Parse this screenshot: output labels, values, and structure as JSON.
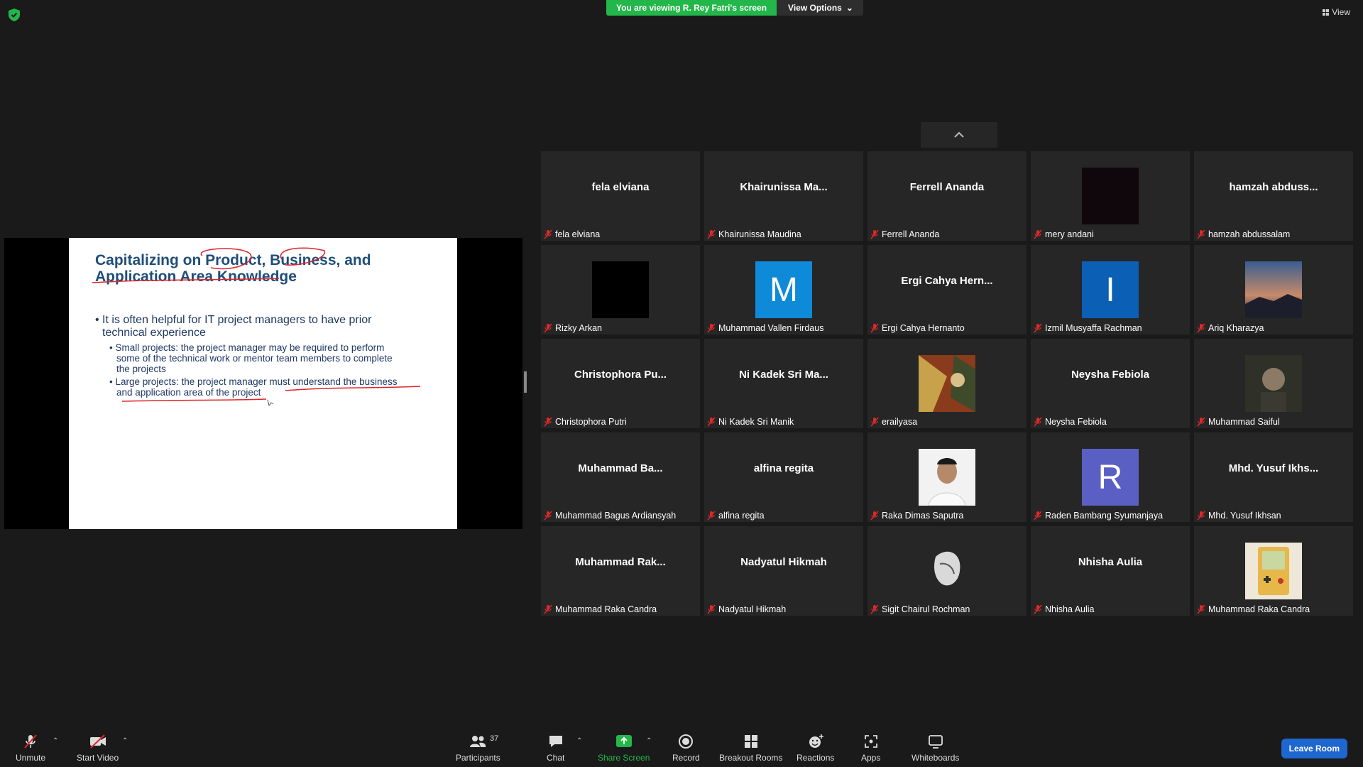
{
  "banner": {
    "viewing_text": "You are viewing R. Rey Fatri's screen",
    "view_options": "View Options"
  },
  "view_label": "View",
  "slide": {
    "title_line1": "Capitalizing on Product, Business, and",
    "title_line2": "Application Area Knowledge",
    "bullet1_line1": "• It is often helpful for IT project managers to have prior",
    "bullet1_line2": "technical experience",
    "sub1_line1": "• Small projects: the project manager may be required to perform",
    "sub1_line2": "some of the technical work or mentor team members to complete",
    "sub1_line3": "the projects",
    "sub2_line1": "• Large projects: the project manager must understand the business",
    "sub2_line2": "and application area of the project"
  },
  "colors": {
    "accent_green": "#23b64a",
    "leave_blue": "#1e66d0",
    "mute_red": "#e02828",
    "tile_bg": "#262626"
  },
  "participants": [
    {
      "display": "fela elviana",
      "name": "fela elviana",
      "avatar": "none"
    },
    {
      "display": "Khairunissa  Ma...",
      "name": "Khairunissa Maudina",
      "avatar": "none"
    },
    {
      "display": "Ferrell Ananda",
      "name": "Ferrell Ananda",
      "avatar": "none"
    },
    {
      "display": "",
      "name": "mery andani",
      "avatar": "dark-photo"
    },
    {
      "display": "hamzah  abduss...",
      "name": "hamzah abdussalam",
      "avatar": "none"
    },
    {
      "display": "",
      "name": "Rizky Arkan",
      "avatar": "black-photo"
    },
    {
      "display": "M",
      "name": "Muhammad Vallen Firdaus",
      "avatar": "letter",
      "color": "#0e8ad9"
    },
    {
      "display": "Ergi  Cahya  Hern...",
      "name": "Ergi Cahya Hernanto",
      "avatar": "none"
    },
    {
      "display": "I",
      "name": "Izmil Musyaffa Rachman",
      "avatar": "letter",
      "color": "#0b5fb5"
    },
    {
      "display": "",
      "name": "Ariq Kharazya",
      "avatar": "sunset-photo"
    },
    {
      "display": "Christophora  Pu...",
      "name": "Christophora Putri",
      "avatar": "none"
    },
    {
      "display": "Ni Kadek Sri Ma...",
      "name": "Ni Kadek Sri Manik",
      "avatar": "none"
    },
    {
      "display": "",
      "name": "erailyasa",
      "avatar": "painting-photo"
    },
    {
      "display": "Neysha Febiola",
      "name": "Neysha Febiola",
      "avatar": "none"
    },
    {
      "display": "",
      "name": "Muhammad Saiful",
      "avatar": "portrait-photo"
    },
    {
      "display": "Muhammad  Ba...",
      "name": "Muhammad Bagus Ardiansyah",
      "avatar": "none"
    },
    {
      "display": "alfina regita",
      "name": "alfina regita",
      "avatar": "none"
    },
    {
      "display": "",
      "name": "Raka Dimas Saputra",
      "avatar": "id-photo"
    },
    {
      "display": "R",
      "name": "Raden Bambang Syumanjaya",
      "avatar": "letter",
      "color": "#5a5fc4"
    },
    {
      "display": "Mhd. Yusuf  Ikhs...",
      "name": "Mhd. Yusuf Ikhsan",
      "avatar": "none"
    },
    {
      "display": "Muhammad  Rak...",
      "name": "Muhammad Raka Candra",
      "avatar": "none"
    },
    {
      "display": "Nadyatul Hikmah",
      "name": "Nadyatul Hikmah",
      "avatar": "none"
    },
    {
      "display": "",
      "name": "Sigit Chairul Rochman",
      "avatar": "sketch-photo"
    },
    {
      "display": "Nhisha Aulia",
      "name": "Nhisha Aulia",
      "avatar": "none"
    },
    {
      "display": "",
      "name": "Muhammad Raka Candra",
      "avatar": "gameboy-photo"
    }
  ],
  "toolbar": {
    "unmute": "Unmute",
    "start_video": "Start Video",
    "participants": "Participants",
    "participants_count": "37",
    "chat": "Chat",
    "share_screen": "Share Screen",
    "record": "Record",
    "breakout_rooms": "Breakout Rooms",
    "reactions": "Reactions",
    "apps": "Apps",
    "whiteboards": "Whiteboards",
    "leave_room": "Leave Room"
  }
}
